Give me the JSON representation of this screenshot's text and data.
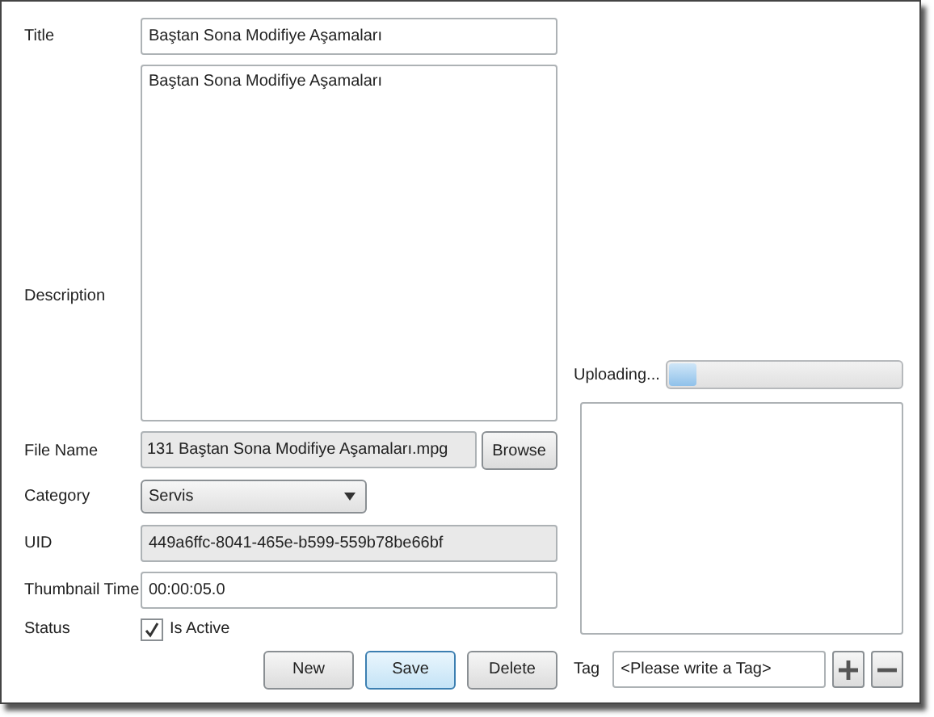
{
  "title": {
    "label": "Title",
    "value": "Baştan Sona Modifiye Aşamaları"
  },
  "description": {
    "label": "Description",
    "value": "Baştan Sona Modifiye Aşamaları"
  },
  "file_name": {
    "label": "File Name",
    "value": "131 Baştan Sona Modifiye Aşamaları.mpg",
    "button": "Browse"
  },
  "category": {
    "label": "Category",
    "value": "Servis"
  },
  "uid": {
    "label": "UID",
    "value": "449a6ffc-8041-465e-b599-559b78be66bf"
  },
  "thumbnail_time": {
    "label": "Thumbnail Time",
    "value": "00:00:05.0"
  },
  "status": {
    "label": "Status",
    "checkbox": "Is Active",
    "checked": true
  },
  "buttons": [
    "New",
    "Save",
    "Delete"
  ],
  "upload": {
    "label": "Uploading...",
    "level": 0.12
  },
  "tag": {
    "label": "Tag",
    "placeholder": "<Please write a Tag>"
  }
}
